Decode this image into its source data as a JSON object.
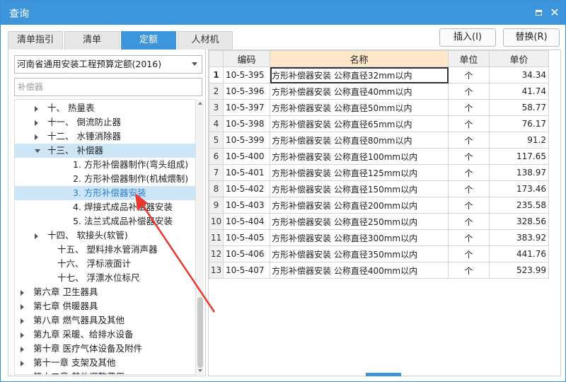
{
  "window": {
    "title": "查询",
    "maximize_icon": "maximize-icon",
    "close_icon": "close-icon"
  },
  "tabs": [
    {
      "label": "清单指引",
      "active": false
    },
    {
      "label": "清单",
      "active": false
    },
    {
      "label": "定额",
      "active": true
    },
    {
      "label": "人材机",
      "active": false
    }
  ],
  "actions": {
    "insert_label": "插入(I)",
    "replace_label": "替换(R)"
  },
  "library": {
    "selected": "河南省通用安装工程预算定额(2016)"
  },
  "search": {
    "value": "",
    "placeholder": "补偿器"
  },
  "tree": [
    {
      "label": "十、  热量表",
      "expandable": true,
      "expanded": false
    },
    {
      "label": "十一、 倒流防止器",
      "expandable": true,
      "expanded": false
    },
    {
      "label": "十二、 水锤消除器",
      "expandable": true,
      "expanded": false
    },
    {
      "label": "十三、 补偿器",
      "expandable": true,
      "expanded": true
    },
    {
      "label": "1. 方形补偿器制作(弯头组成)",
      "expandable": false
    },
    {
      "label": "2. 方形补偿器制作(机械煨制)",
      "expandable": false
    },
    {
      "label": "3. 方形补偿器安装",
      "expandable": false,
      "selected": true
    },
    {
      "label": "4. 焊接式成品补偿器安装",
      "expandable": false
    },
    {
      "label": "5. 法兰式成品补偿器安装",
      "expandable": false
    },
    {
      "label": "十四、 软接头(软管)",
      "expandable": true,
      "expanded": false
    },
    {
      "label": "十五、 塑料排水管消声器",
      "expandable": false
    },
    {
      "label": "十六、 浮标液面计",
      "expandable": false
    },
    {
      "label": "十七、 浮漂水位标尺",
      "expandable": false
    },
    {
      "label": "第六章 卫生器具",
      "expandable": true,
      "expanded": false
    },
    {
      "label": "第七章 供暖器具",
      "expandable": true,
      "expanded": false
    },
    {
      "label": "第八章 燃气器具及其他",
      "expandable": true,
      "expanded": false
    },
    {
      "label": "第九章 采暖、给排水设备",
      "expandable": true,
      "expanded": false
    },
    {
      "label": "第十章 医疗气体设备及附件",
      "expandable": true,
      "expanded": false
    },
    {
      "label": "第十一章 支架及其他",
      "expandable": true,
      "expanded": false
    },
    {
      "label": "第十二章 其他调整费用",
      "expandable": true,
      "expanded": false
    }
  ],
  "table": {
    "columns": [
      "编码",
      "名称",
      "单位",
      "单价"
    ],
    "rows": [
      {
        "no": "1",
        "code": "10-5-395",
        "name": "方形补偿器安装 公称直径32mm以内",
        "unit": "个",
        "price": "34.34"
      },
      {
        "no": "2",
        "code": "10-5-396",
        "name": "方形补偿器安装 公称直径40mm以内",
        "unit": "个",
        "price": "41.74"
      },
      {
        "no": "3",
        "code": "10-5-397",
        "name": "方形补偿器安装 公称直径50mm以内",
        "unit": "个",
        "price": "58.77"
      },
      {
        "no": "4",
        "code": "10-5-398",
        "name": "方形补偿器安装 公称直径65mm以内",
        "unit": "个",
        "price": "76.17"
      },
      {
        "no": "5",
        "code": "10-5-399",
        "name": "方形补偿器安装 公称直径80mm以内",
        "unit": "个",
        "price": "91.2"
      },
      {
        "no": "6",
        "code": "10-5-400",
        "name": "方形补偿器安装 公称直径100mm以内",
        "unit": "个",
        "price": "117.65"
      },
      {
        "no": "7",
        "code": "10-5-401",
        "name": "方形补偿器安装 公称直径125mm以内",
        "unit": "个",
        "price": "138.97"
      },
      {
        "no": "8",
        "code": "10-5-402",
        "name": "方形补偿器安装 公称直径150mm以内",
        "unit": "个",
        "price": "173.46"
      },
      {
        "no": "9",
        "code": "10-5-403",
        "name": "方形补偿器安装 公称直径200mm以内",
        "unit": "个",
        "price": "235.58"
      },
      {
        "no": "10",
        "code": "10-5-404",
        "name": "方形补偿器安装 公称直径250mm以内",
        "unit": "个",
        "price": "328.56"
      },
      {
        "no": "11",
        "code": "10-5-405",
        "name": "方形补偿器安装 公称直径300mm以内",
        "unit": "个",
        "price": "383.92"
      },
      {
        "no": "12",
        "code": "10-5-406",
        "name": "方形补偿器安装 公称直径350mm以内",
        "unit": "个",
        "price": "441.76"
      },
      {
        "no": "13",
        "code": "10-5-407",
        "name": "方形补偿器安装 公称直径400mm以内",
        "unit": "个",
        "price": "523.99"
      }
    ]
  },
  "colors": {
    "accent": "#3d95dc",
    "selected_text": "#2b7cd3",
    "highlight_row": "#cde6f7",
    "name_header": "#fde7c8",
    "annotation_arrow": "#e8382f"
  }
}
